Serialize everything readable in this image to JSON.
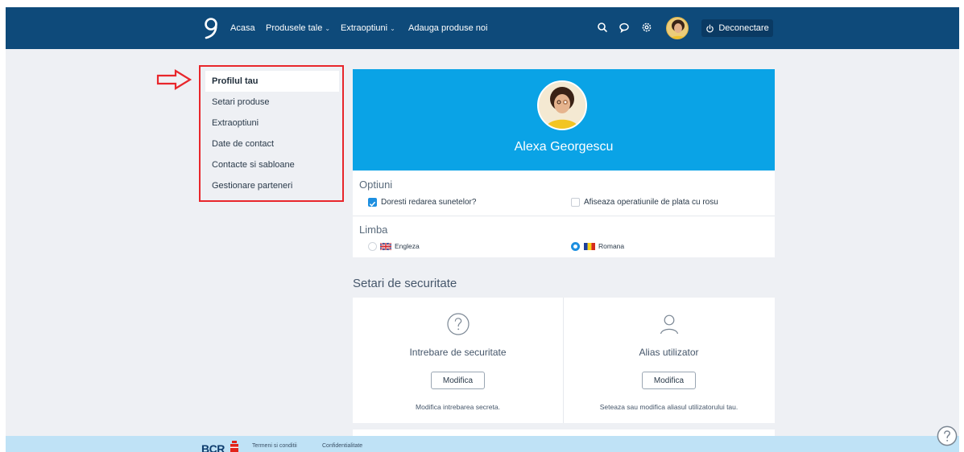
{
  "header": {
    "nav": [
      {
        "label": "Acasa",
        "dropdown": false
      },
      {
        "label": "Produsele tale",
        "dropdown": true
      },
      {
        "label": "Extraoptiuni",
        "dropdown": true
      },
      {
        "label": "Adauga produse noi",
        "dropdown": false
      }
    ],
    "icons": [
      "search-icon",
      "chat-icon",
      "settings-icon"
    ],
    "logout_label": "Deconectare",
    "bar_color": "#0e4a7a"
  },
  "sidebar": {
    "items": [
      {
        "label": "Profilul tau",
        "active": true
      },
      {
        "label": "Setari produse",
        "active": false
      },
      {
        "label": "Extraoptiuni",
        "active": false
      },
      {
        "label": "Date de contact",
        "active": false
      },
      {
        "label": "Contacte si sabloane",
        "active": false
      },
      {
        "label": "Gestionare parteneri",
        "active": false
      }
    ],
    "highlight_color": "#e8262b"
  },
  "profile": {
    "name": "Alexa Georgescu",
    "card_color": "#0aa3e6"
  },
  "options": {
    "title": "Optiuni",
    "checkboxes": [
      {
        "label": "Doresti redarea sunetelor?",
        "checked": true
      },
      {
        "label": "Afiseaza operatiunile de plata cu rosu",
        "checked": false
      }
    ],
    "language_title": "Limba",
    "languages": [
      {
        "label": "Engleza",
        "flag": "uk-flag",
        "selected": false
      },
      {
        "label": "Romana",
        "flag": "ro-flag",
        "selected": true
      }
    ]
  },
  "security": {
    "heading": "Setari de securitate",
    "items": [
      {
        "title": "Intrebare de securitate",
        "button": "Modifica",
        "description": "Modifica intrebarea secreta.",
        "icon": "question-circle-icon"
      },
      {
        "title": "Alias utilizator",
        "button": "Modifica",
        "description": "Seteaza sau modifica aliasul utilizatorului tau.",
        "icon": "user-icon"
      }
    ]
  },
  "footer": {
    "brand": "BCR",
    "links": [
      "Termeni si conditii",
      "Confidentialitate"
    ],
    "bar_color": "#bfe2f6"
  }
}
